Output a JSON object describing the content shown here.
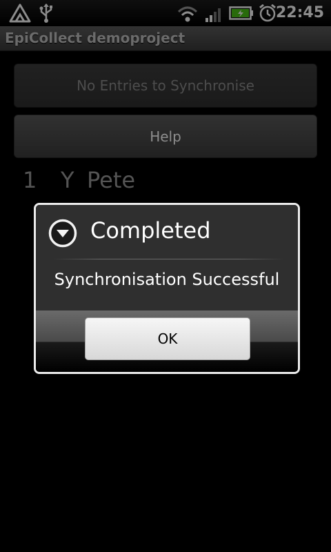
{
  "status_bar": {
    "time": "22:45",
    "icons": [
      "warning-icon",
      "usb-icon",
      "wifi-icon",
      "signal-icon",
      "battery-charging-icon",
      "alarm-icon"
    ]
  },
  "app": {
    "title": "EpiCollect demoproject"
  },
  "main": {
    "sync_button_label": "No Entries to Synchronise",
    "help_button_label": "Help",
    "entries": [
      {
        "number": "1",
        "flag": "Y",
        "name": "Pete"
      }
    ]
  },
  "dialog": {
    "title": "Completed",
    "message": "Synchronisation Successful",
    "ok_label": "OK",
    "icon": "chevron-down-circle-icon"
  },
  "colors": {
    "background": "#000000",
    "title_bar": "#4a4a4a",
    "disabled_text": "#8c8c8c",
    "battery_green": "#4cc417"
  }
}
